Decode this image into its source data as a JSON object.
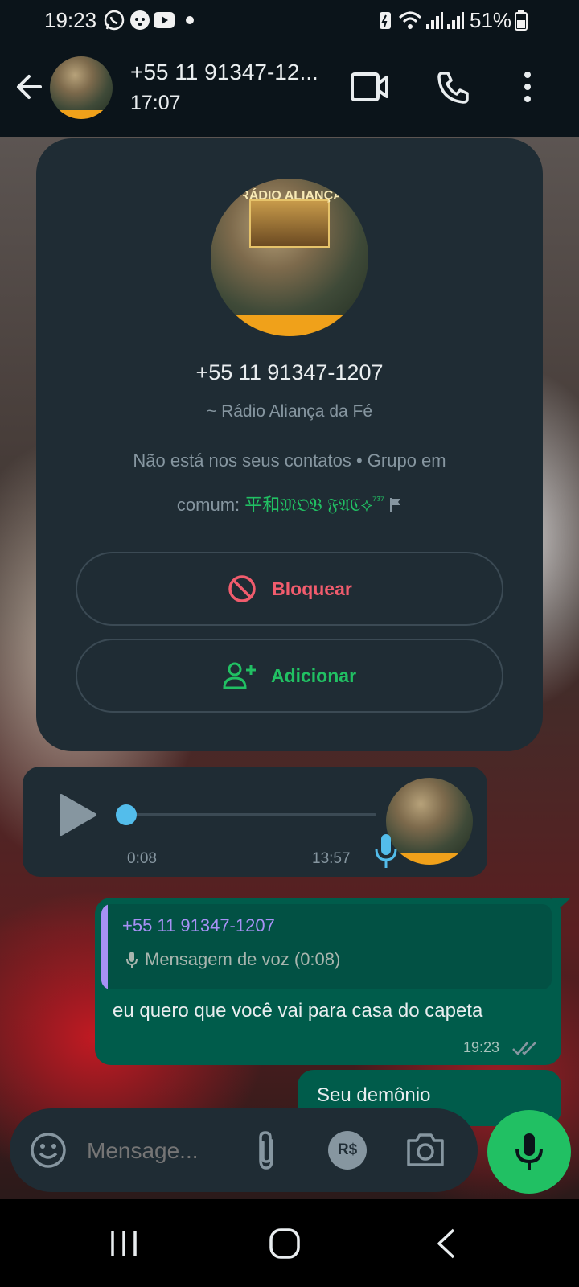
{
  "status_bar": {
    "time": "19:23",
    "battery": "51%",
    "app_icons": [
      "whatsapp-icon",
      "messenger-dog-icon",
      "youtube-icon",
      "dot-icon"
    ],
    "system_icons": [
      "battery-saver-icon",
      "wifi-icon",
      "signal-icon",
      "signal-icon",
      "battery-icon"
    ]
  },
  "header": {
    "title": "+55 11 91347-12...",
    "subtitle": "17:07",
    "icons": [
      "back-arrow-icon",
      "video-call-icon",
      "phone-icon",
      "more-vert-icon"
    ]
  },
  "contact_card": {
    "avatar_text": "RÁDIO ALIANÇA",
    "phone": "+55 11 91347-1207",
    "name": "~ Rádio Aliança da Fé",
    "info_line1": "Não está nos seus contatos • Grupo em",
    "info_prefix": "comum: ",
    "group_name": "平和𝔐𝔒𝔅 𝔉𝔄ℭ⟡",
    "group_suffix": "⁷³⁷",
    "block_label": "Bloquear",
    "add_label": "Adicionar",
    "block_color": "#f15c6d",
    "add_color": "#21c063"
  },
  "voice_message": {
    "duration": "0:08",
    "time": "13:57",
    "progress": 0.0
  },
  "reply_message": {
    "quoted_sender": "+55 11 91347-1207",
    "quoted_text": "Mensagem de voz (0:08)",
    "text": "eu quero que você vai para casa do capeta",
    "time": "19:23"
  },
  "next_message": {
    "text": "Seu demônio"
  },
  "composer": {
    "placeholder": "Mensage...",
    "icons": [
      "emoji-icon",
      "attach-icon",
      "payment-icon",
      "camera-icon",
      "mic-icon"
    ]
  },
  "nav_bar": {
    "icons": [
      "recents-icon",
      "home-icon",
      "back-icon"
    ]
  }
}
